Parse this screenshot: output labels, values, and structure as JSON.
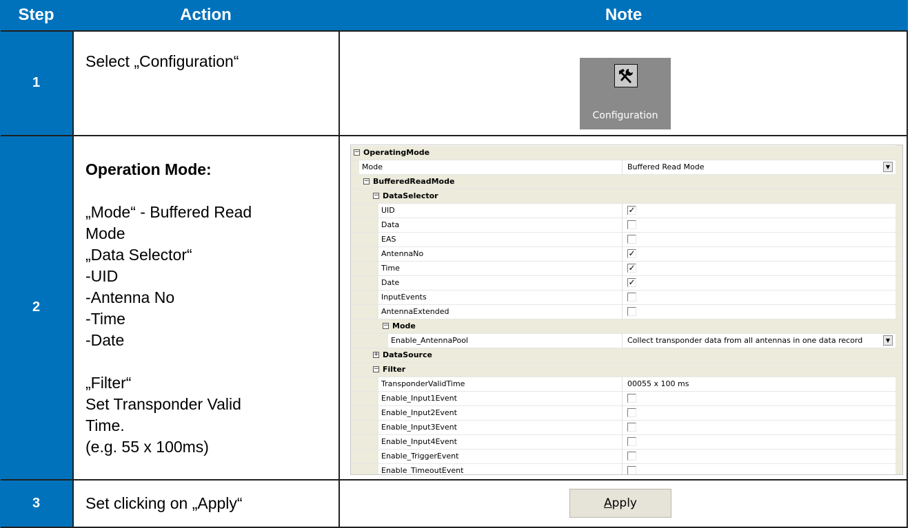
{
  "header": {
    "step": "Step",
    "action": "Action",
    "note": "Note"
  },
  "rows": [
    {
      "step": "1",
      "action": "Select „Configuration“"
    },
    {
      "step": "2",
      "action_title": "Operation Mode:",
      "action_lines": " „Mode“ - Buffered Read\nMode\n„Data Selector“\n-UID\n-Antenna No\n-Time\n-Date\n\n„Filter“\nSet Transponder Valid\nTime.\n(e.g. 55 x 100ms)"
    },
    {
      "step": "3",
      "action": "Set clicking on „Apply“"
    }
  ],
  "config_button": {
    "label": "Configuration",
    "icon": "wrench-hammer-icon"
  },
  "property_grid": {
    "rows": [
      {
        "kind": "category",
        "indent": 0,
        "name": "OperatingMode",
        "expander": "⊟"
      },
      {
        "kind": "property",
        "indent": 0,
        "name": "Mode",
        "value": "Buffered Read Mode",
        "dropdown": true
      },
      {
        "kind": "category",
        "indent": 1,
        "name": "BufferedReadMode",
        "expander": "⊟"
      },
      {
        "kind": "category",
        "indent": 2,
        "name": "DataSelector",
        "expander": "⊟"
      },
      {
        "kind": "checkbox",
        "indent": 2,
        "name": "UID",
        "checked": true
      },
      {
        "kind": "checkbox",
        "indent": 2,
        "name": "Data",
        "checked": false
      },
      {
        "kind": "checkbox",
        "indent": 2,
        "name": "EAS",
        "checked": false
      },
      {
        "kind": "checkbox",
        "indent": 2,
        "name": "AntennaNo",
        "checked": true
      },
      {
        "kind": "checkbox",
        "indent": 2,
        "name": "Time",
        "checked": true
      },
      {
        "kind": "checkbox",
        "indent": 2,
        "name": "Date",
        "checked": true
      },
      {
        "kind": "checkbox",
        "indent": 2,
        "name": "InputEvents",
        "checked": false
      },
      {
        "kind": "checkbox",
        "indent": 2,
        "name": "AntennaExtended",
        "checked": false
      },
      {
        "kind": "category",
        "indent": 3,
        "name": "Mode",
        "expander": "⊟"
      },
      {
        "kind": "property",
        "indent": 3,
        "name": "Enable_AntennaPool",
        "value": "Collect transponder data from all antennas in one data record",
        "dropdown": true
      },
      {
        "kind": "category",
        "indent": 2,
        "name": "DataSource",
        "expander": "⊞"
      },
      {
        "kind": "category",
        "indent": 2,
        "name": "Filter",
        "expander": "⊟"
      },
      {
        "kind": "property",
        "indent": 2,
        "name": "TransponderValidTime",
        "value": "00055 x 100 ms",
        "dropdown": false
      },
      {
        "kind": "checkbox",
        "indent": 2,
        "name": "Enable_Input1Event",
        "checked": false
      },
      {
        "kind": "checkbox",
        "indent": 2,
        "name": "Enable_Input2Event",
        "checked": false
      },
      {
        "kind": "checkbox",
        "indent": 2,
        "name": "Enable_Input3Event",
        "checked": false
      },
      {
        "kind": "checkbox",
        "indent": 2,
        "name": "Enable_Input4Event",
        "checked": false
      },
      {
        "kind": "checkbox",
        "indent": 2,
        "name": "Enable_TriggerEvent",
        "checked": false
      },
      {
        "kind": "checkbox",
        "indent": 2,
        "name": "Enable_TimeoutEvent",
        "checked": false
      }
    ]
  },
  "apply_button": {
    "mnemonic": "A",
    "rest": "pply"
  },
  "colors": {
    "header_blue": "#0072bc",
    "grid_margin": "#ecebdc"
  }
}
